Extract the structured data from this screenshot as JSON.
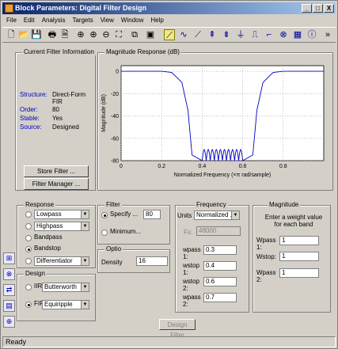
{
  "window": {
    "title": "Block Parameters: Digital Filter Design",
    "min": "_",
    "max": "□",
    "close": "X"
  },
  "menu": [
    "File",
    "Edit",
    "Analysis",
    "Targets",
    "View",
    "Window",
    "Help"
  ],
  "toolbar": {
    "overflow": "»"
  },
  "filter_info": {
    "title": "Current Filter Information",
    "structure_label": "Structure:",
    "structure_value": "Direct-Form FIR",
    "order_label": "Order:",
    "order_value": "80",
    "stable_label": "Stable:",
    "stable_value": "Yes",
    "source_label": "Source:",
    "source_value": "Designed",
    "store_button": "Store Filter ...",
    "manager_button": "Filter Manager ..."
  },
  "magnitude_plot": {
    "title": "Magnitude Response (dB)",
    "xlabel": "Normalized Frequency (×π rad/sample)",
    "ylabel": "Magnitude (dB)"
  },
  "chart_data": {
    "type": "line",
    "xlabel": "Normalized Frequency (×π rad/sample)",
    "ylabel": "Magnitude (dB)",
    "xlim": [
      0,
      1
    ],
    "ylim": [
      -80,
      5
    ],
    "xticks": [
      "0",
      "0.2",
      "0.4",
      "0.6",
      "0.8"
    ],
    "yticks": [
      "0",
      "-20",
      "-40",
      "-60",
      "-80"
    ],
    "grid": true,
    "series": [
      {
        "x": [
          0,
          0.2,
          0.25,
          0.3,
          0.33,
          0.35,
          0.4,
          0.6,
          0.65,
          0.67,
          0.7,
          0.75,
          0.8,
          1
        ],
        "y": [
          0,
          0,
          -1,
          -10,
          -35,
          -75,
          -80,
          -80,
          -75,
          -35,
          -10,
          -1,
          0,
          0
        ]
      }
    ],
    "ripple_band": [
      0.4,
      0.6
    ],
    "ripple_floor": -80,
    "ripple_top": -70,
    "ripple_lobes": 10,
    "line_color": "#0000c0"
  },
  "response": {
    "title": "Response",
    "options": [
      "Lowpass",
      "Highpass",
      "Bandpass",
      "Bandstop",
      "Differentiator"
    ],
    "selected": "Bandstop",
    "lowpass_combo": "Lowpass",
    "highpass_combo": "Highpass",
    "diff_combo": "Differentiator"
  },
  "design": {
    "title": "Design",
    "iir_label": "IIR",
    "iir_value": "Butterworth",
    "fir_label": "FIR",
    "fir_value": "Equiripple",
    "selected": "FIR"
  },
  "filter_order": {
    "title": "Filter",
    "specify_label": "Specify ...",
    "specify_value": "80",
    "minimum_label": "Minimum..."
  },
  "options": {
    "title": "Optio",
    "density_label": "Density",
    "density_value": "16"
  },
  "frequency": {
    "title": "Frequency",
    "units_label": "Units",
    "units_value": "Normalized ...",
    "fs_label": "Fs:",
    "fs_value": "48000",
    "fields": [
      {
        "label": "wpass 1:",
        "value": "0.3"
      },
      {
        "label": "wstop 1:",
        "value": "0.4"
      },
      {
        "label": "wstop 2:",
        "value": "0.6"
      },
      {
        "label": "wpass 2:",
        "value": "0.7"
      }
    ]
  },
  "magnitude": {
    "title": "Magnitude",
    "instructions": "Enter a weight value for each band",
    "fields": [
      {
        "label": "Wpass 1:",
        "value": "1"
      },
      {
        "label": "Wstop:",
        "value": "1"
      },
      {
        "label": "Wpass 2:",
        "value": "1"
      }
    ]
  },
  "design_button": "Design Filter",
  "status": "Ready"
}
